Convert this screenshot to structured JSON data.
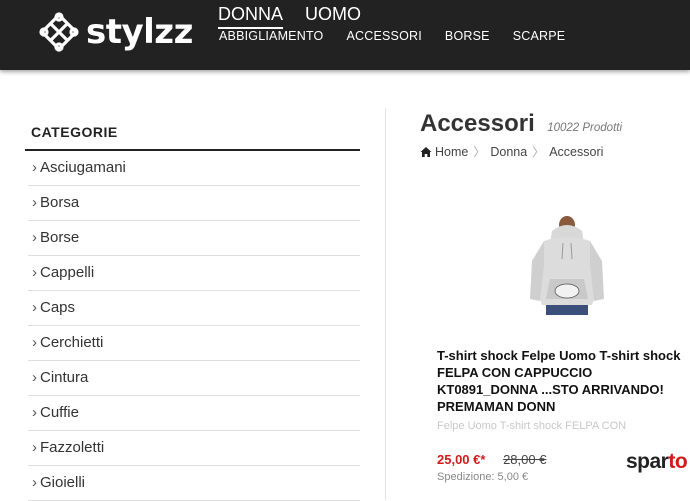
{
  "header": {
    "logo_text": "stylzz",
    "main_nav": [
      {
        "label": "DONNA",
        "active": true
      },
      {
        "label": "UOMO",
        "active": false
      }
    ],
    "sub_nav": [
      "ABBIGLIAMENTO",
      "ACCESSORI",
      "BORSE",
      "SCARPE"
    ]
  },
  "sidebar": {
    "title": "CATEGORIE",
    "items": [
      "Asciugamani",
      "Borsa",
      "Borse",
      "Cappelli",
      "Caps",
      "Cerchietti",
      "Cintura",
      "Cuffie",
      "Fazzoletti",
      "Gioielli"
    ]
  },
  "main": {
    "title": "Accessori",
    "product_count": "10022 Prodotti",
    "breadcrumb": [
      "Home",
      "Donna",
      "Accessori"
    ],
    "product": {
      "title": "T-shirt shock Felpe Uomo T-shirt shock\nFELPA CON CAPPUCCIO\nKT0891_DONNA ...STO ARRIVANDO!\nPREMAMAN DONN",
      "description": "Felpe Uomo T-shirt shock FELPA CON",
      "price": "25,00 €*",
      "old_price": "28,00 €",
      "shipping": "Spedizione: 5,00 €",
      "brand_part1": "spar",
      "brand_part2": "to"
    }
  },
  "colors": {
    "header_bg": "#222222",
    "price": "#d01b1b"
  }
}
